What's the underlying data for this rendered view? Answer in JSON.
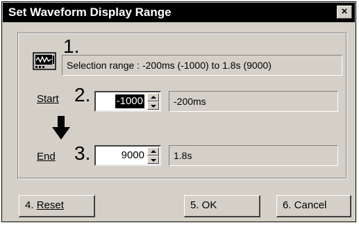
{
  "window": {
    "title": "Set Waveform Display Range",
    "close_label": "×"
  },
  "step_numbers": {
    "one": "1.",
    "two": "2.",
    "three": "3."
  },
  "selection": {
    "icon": "oscilloscope-icon",
    "text": "Selection range : -200ms (-1000) to 1.8s (9000)"
  },
  "start": {
    "label": "Start",
    "value": "-1000",
    "display": "-200ms"
  },
  "end": {
    "label": "End",
    "value": "9000",
    "display": "1.8s"
  },
  "buttons": {
    "reset_num": "4.",
    "reset": "Reset",
    "ok": "5.   OK",
    "cancel": "6. Cancel"
  },
  "colors": {
    "face": "#d4d0c8",
    "titlebar": "#000000"
  }
}
